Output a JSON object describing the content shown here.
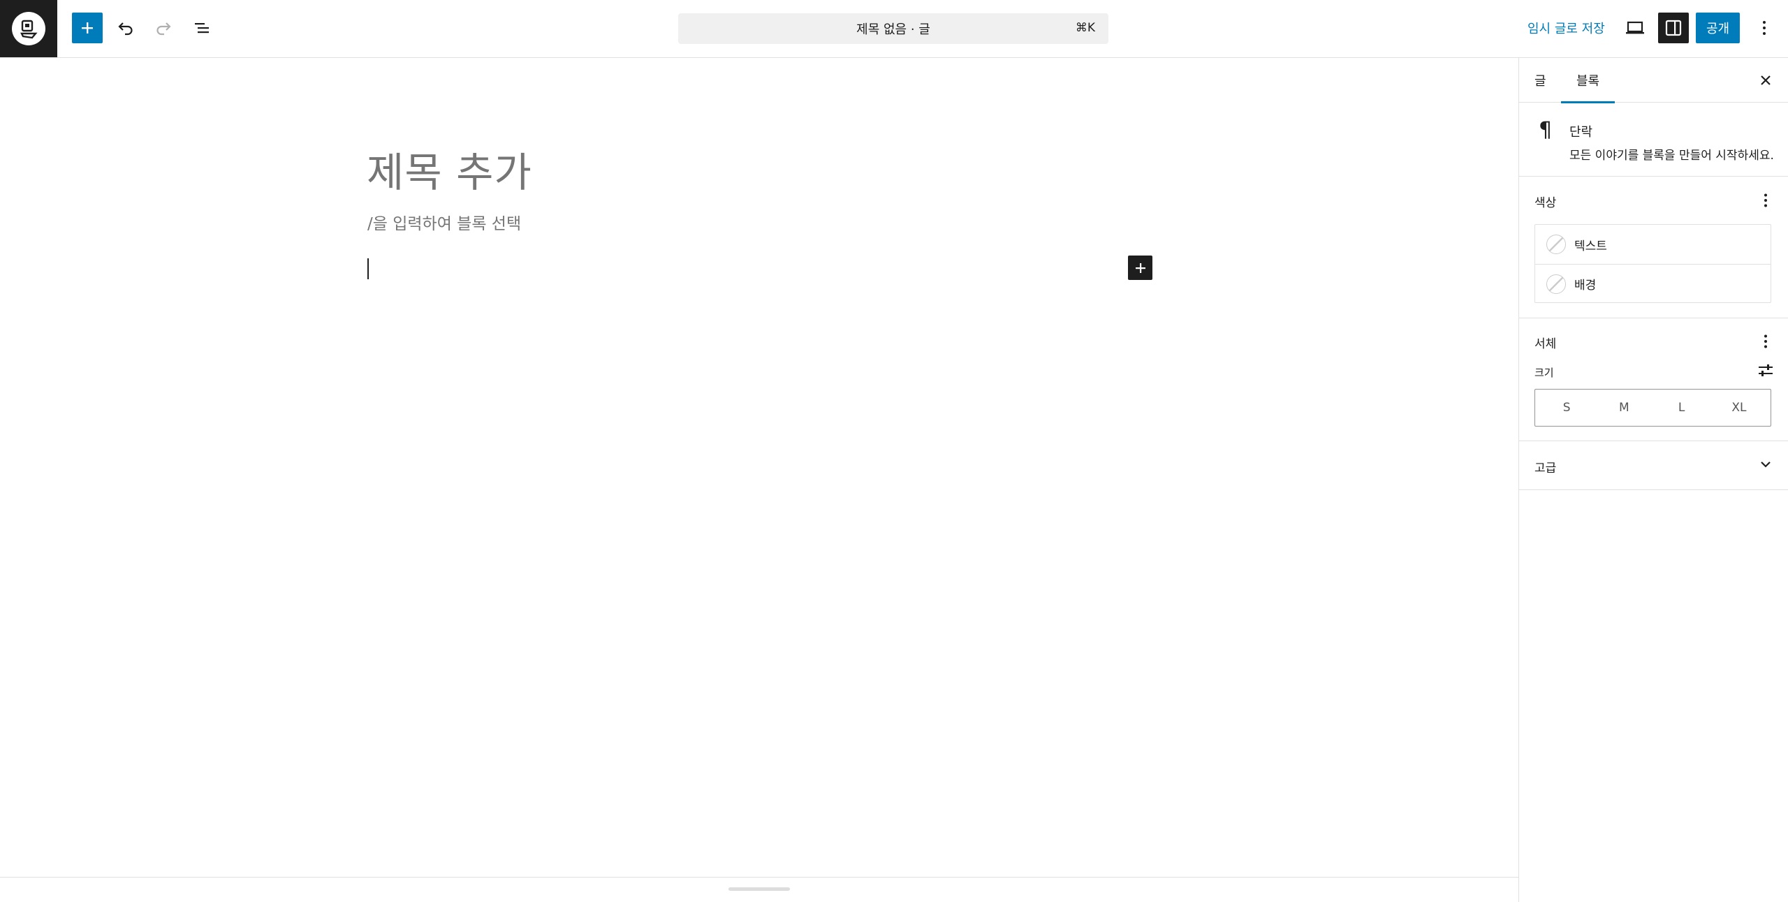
{
  "toolbar": {
    "add_block_label": "",
    "command_bar_text": "제목 없음 · 글",
    "command_bar_shortcut": "⌘K",
    "save_draft_label": "임시 글로 저장",
    "publish_label": "공개"
  },
  "editor": {
    "title_placeholder": "제목 추가",
    "block_hint": "/을 입력하여 블록 선택"
  },
  "sidebar": {
    "tabs": [
      {
        "label": "글",
        "active": false
      },
      {
        "label": "블록",
        "active": true
      }
    ],
    "block": {
      "name": "단락",
      "description": "모든 이야기를 블록을 만들어 시작하세요."
    },
    "color_panel": {
      "title": "색상",
      "items": [
        {
          "label": "텍스트"
        },
        {
          "label": "배경"
        }
      ]
    },
    "typography_panel": {
      "title": "서체",
      "size_label": "크기",
      "size_options": [
        "S",
        "M",
        "L",
        "XL"
      ]
    },
    "advanced_panel": {
      "title": "고급"
    }
  },
  "colors": {
    "accent": "#007cba",
    "dark": "#1e1e1e",
    "placeholder": "#757575",
    "border": "#e0e0e0"
  }
}
